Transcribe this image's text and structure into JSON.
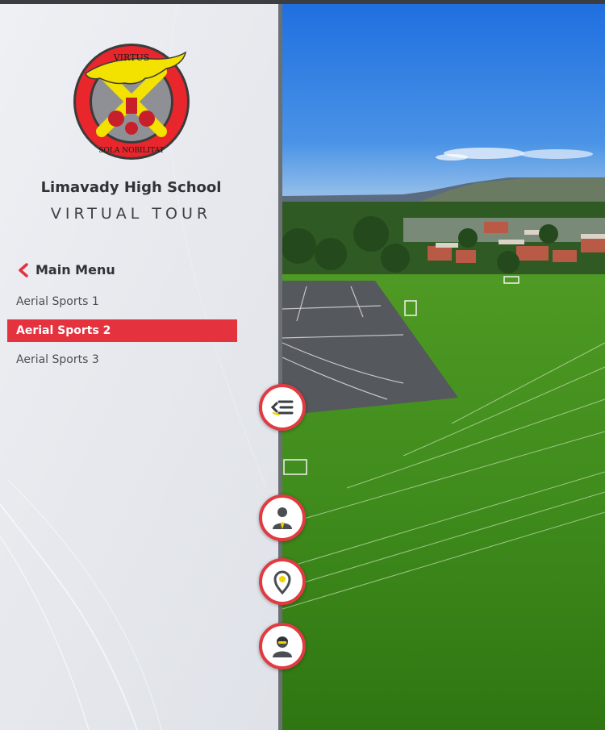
{
  "app": {
    "school_name": "Limavady High School",
    "tour_title": "VIRTUAL TOUR"
  },
  "logo": {
    "top_text": "VIRTUS",
    "bottom_text": "SOLA NOBILITAT"
  },
  "nav": {
    "main_menu_label": "Main Menu",
    "items": [
      {
        "label": "Aerial Sports 1",
        "active": false
      },
      {
        "label": "Aerial Sports 2",
        "active": true
      },
      {
        "label": "Aerial Sports 3",
        "active": false
      }
    ]
  },
  "controls": {
    "toggle_menu_icon": "collapse-menu-icon",
    "buttons": [
      {
        "icon": "staff-person-icon"
      },
      {
        "icon": "map-pin-icon"
      },
      {
        "icon": "guide-person-icon"
      }
    ]
  },
  "colors": {
    "accent_red": "#e5323f",
    "logo_yellow": "#f3e100",
    "logo_red": "#e8262c",
    "sidebar_text": "#2f3236"
  }
}
